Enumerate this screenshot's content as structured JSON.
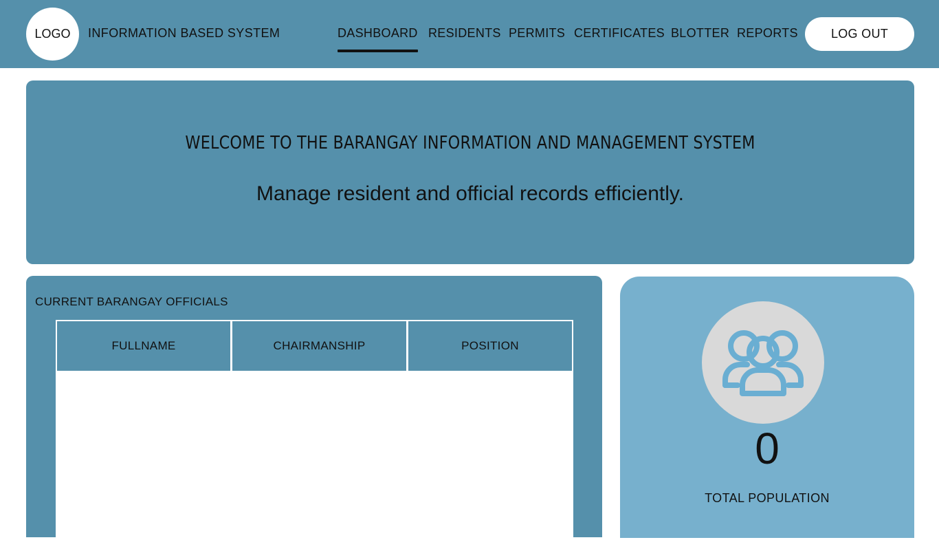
{
  "header": {
    "logo_text": "LOGO",
    "brand": "INFORMATION BASED SYSTEM",
    "nav": [
      {
        "label": "DASHBOARD",
        "active": true
      },
      {
        "label": "RESIDENTS",
        "active": false
      },
      {
        "label": "PERMITS",
        "active": false
      },
      {
        "label": "CERTIFICATES",
        "active": false
      },
      {
        "label": "BLOTTER",
        "active": false
      },
      {
        "label": "REPORTS",
        "active": false
      }
    ],
    "logout_label": "LOG OUT"
  },
  "hero": {
    "title": "WELCOME TO THE BARANGAY INFORMATION AND MANAGEMENT SYSTEM",
    "subtitle": "Manage resident and official records efficiently."
  },
  "officials": {
    "title": "CURRENT BARANGAY OFFICIALS",
    "columns": [
      "FULLNAME",
      "CHAIRMANSHIP",
      "POSITION"
    ],
    "rows": []
  },
  "population": {
    "icon": "users-group-icon",
    "count": "0",
    "label": "TOTAL POPULATION"
  },
  "colors": {
    "primary": "#5590ab",
    "card": "#77b0cd",
    "icon_bg": "#d9d9d9",
    "icon_stroke": "#6aaed2"
  }
}
